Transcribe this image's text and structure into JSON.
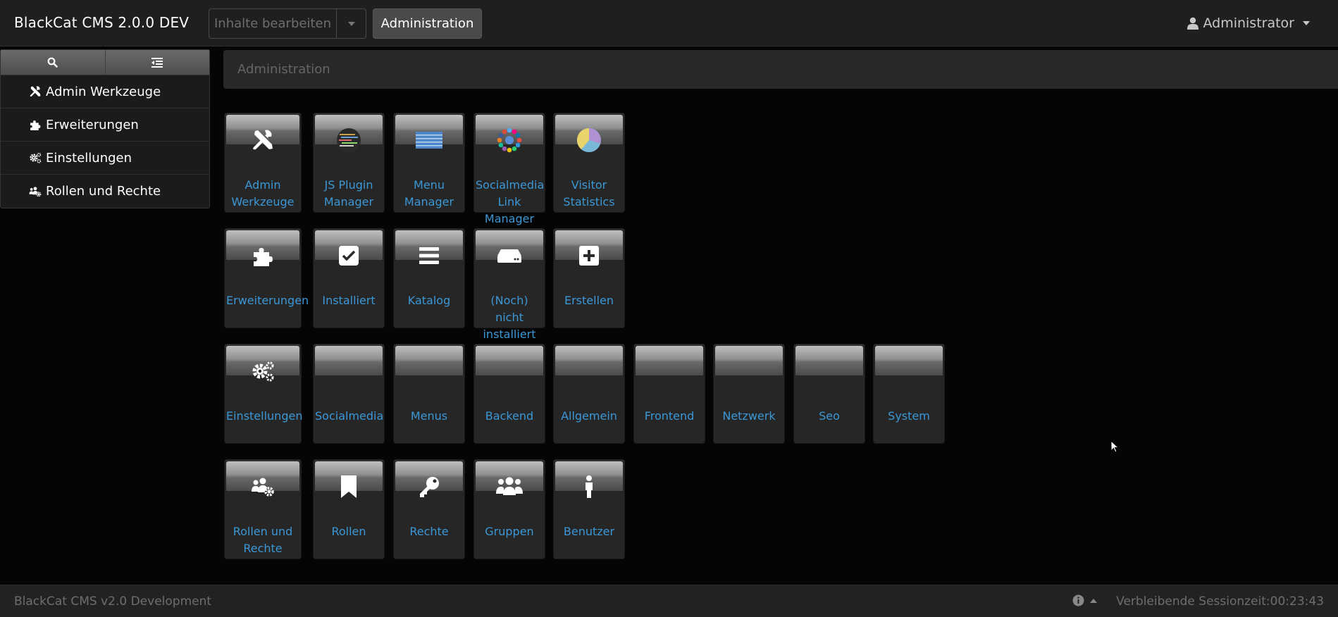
{
  "header": {
    "brand": "BlackCat CMS 2.0.0 DEV",
    "edit_button": "Inhalte bearbeiten",
    "admin_button": "Administration",
    "user_label": "Administrator"
  },
  "sidebar": {
    "items": [
      {
        "label": "Admin Werkzeuge",
        "icon": "tools-icon"
      },
      {
        "label": "Erweiterungen",
        "icon": "puzzle-icon"
      },
      {
        "label": "Einstellungen",
        "icon": "gears-icon"
      },
      {
        "label": "Rollen und Rechte",
        "icon": "users-gear-icon"
      }
    ]
  },
  "breadcrumb": "Administration",
  "rows": [
    [
      {
        "label": "Admin Werkzeuge",
        "icon": "tools-icon"
      },
      {
        "label": "JS Plugin Manager",
        "icon": "code-image-icon"
      },
      {
        "label": "Menu Manager",
        "icon": "menu-image-icon"
      },
      {
        "label": "Socialmedia Link Manager",
        "icon": "social-circle-icon"
      },
      {
        "label": "Visitor Statistics",
        "icon": "pie-chart-icon"
      }
    ],
    [
      {
        "label": "Erweiterungen",
        "icon": "puzzle-icon"
      },
      {
        "label": "Installiert",
        "icon": "check-square-icon"
      },
      {
        "label": "Katalog",
        "icon": "list-icon"
      },
      {
        "label": "(Noch) nicht installiert",
        "icon": "hdd-icon"
      },
      {
        "label": "Erstellen",
        "icon": "plus-square-icon"
      }
    ],
    [
      {
        "label": "Einstellungen",
        "icon": "gears-icon"
      },
      {
        "label": "Socialmedia",
        "icon": ""
      },
      {
        "label": "Menus",
        "icon": ""
      },
      {
        "label": "Backend",
        "icon": ""
      },
      {
        "label": "Allgemein",
        "icon": ""
      },
      {
        "label": "Frontend",
        "icon": ""
      },
      {
        "label": "Netzwerk",
        "icon": ""
      },
      {
        "label": "Seo",
        "icon": ""
      },
      {
        "label": "System",
        "icon": ""
      }
    ],
    [
      {
        "label": "Rollen und Rechte",
        "icon": "users-gear-icon"
      },
      {
        "label": "Rollen",
        "icon": "bookmark-icon"
      },
      {
        "label": "Rechte",
        "icon": "key-icon"
      },
      {
        "label": "Gruppen",
        "icon": "users-icon"
      },
      {
        "label": "Benutzer",
        "icon": "user-icon"
      }
    ]
  ],
  "footer": {
    "left": "BlackCat CMS v2.0 Development",
    "right": "Verbleibende Sessionzeit:00:23:43"
  },
  "colors": {
    "link": "#3b97d6",
    "navbar": "#1f1f1f",
    "background": "#050505"
  }
}
